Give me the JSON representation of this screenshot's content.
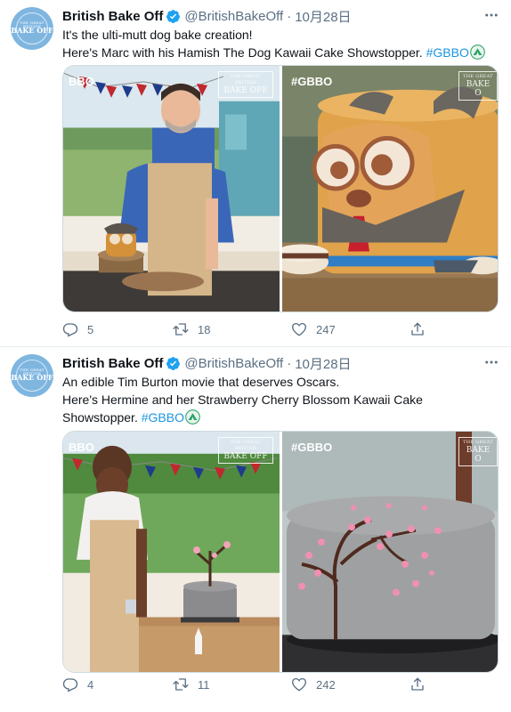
{
  "colors": {
    "accent": "#1b95e0",
    "secondary_text": "#5b7083",
    "border": "#e6ecf0",
    "avatar_bg": "#7fb6e0"
  },
  "tweets": [
    {
      "author": {
        "name": "British Bake Off",
        "handle": "@BritishBakeOff",
        "verified_icon": "verified-badge-icon",
        "avatar_line1": "THE GREAT BRITISH",
        "avatar_line2": "BAKE OFF"
      },
      "separator": "·",
      "date": "10月28日",
      "text_lines": [
        "It's the ulti-mutt dog bake creation!",
        "Here's Marc with his Hamish The Dog Kawaii Cake Showstopper."
      ],
      "hashtag": "#GBBO",
      "emoji_icon": "tent-emoji-icon",
      "media": {
        "left_watermark": "BBO",
        "left_logo": [
          "THE GREAT BRITISH",
          "BAKE OFF"
        ],
        "right_watermark": "#GBBO",
        "right_logo": [
          "THE GREAT",
          "BAKE O"
        ]
      },
      "stats": {
        "replies": "5",
        "retweets": "18",
        "likes": "247"
      }
    },
    {
      "author": {
        "name": "British Bake Off",
        "handle": "@BritishBakeOff",
        "verified_icon": "verified-badge-icon",
        "avatar_line1": "THE GREAT BRITISH",
        "avatar_line2": "BAKE OFF"
      },
      "separator": "·",
      "date": "10月28日",
      "text_lines": [
        "An edible Tim Burton movie that deserves Oscars.",
        "Here's Hermine and her Strawberry Cherry Blossom Kawaii Cake",
        "Showstopper."
      ],
      "hashtag": "#GBBO",
      "emoji_icon": "tent-emoji-icon",
      "media": {
        "left_watermark": "BBO",
        "left_logo": [
          "THE GREAT BRITISH",
          "BAKE OFF"
        ],
        "right_watermark": "#GBBO",
        "right_logo": [
          "THE GREAT",
          "BAKE O"
        ]
      },
      "stats": {
        "replies": "4",
        "retweets": "11",
        "likes": "242"
      }
    }
  ]
}
